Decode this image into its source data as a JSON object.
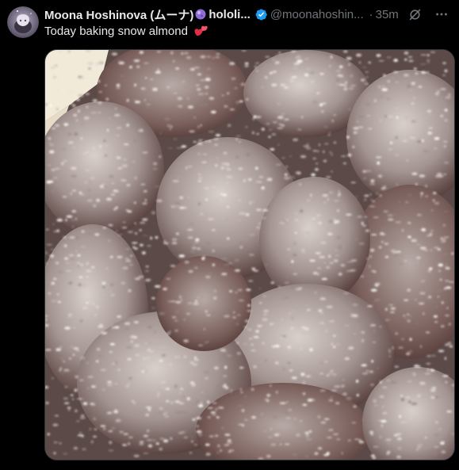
{
  "tweet": {
    "author": {
      "display_name": "Moona Hoshinova (ムーナ)",
      "display_name_suffix": "hololi...",
      "handle": "@moonahoshin...",
      "verified": true,
      "avatar_icon": "avatar-icon"
    },
    "time_sep": "·",
    "time": "35m",
    "text": "Today baking snow almond",
    "text_emoji": "two-hearts-emoji",
    "media": {
      "type": "photo",
      "icon": "photo-snow-almond-image"
    }
  },
  "colors": {
    "background": "#000000",
    "text": "#e7e9ea",
    "secondary": "#71767b",
    "verified": "#1d9bf0",
    "heart": "#f91880"
  }
}
